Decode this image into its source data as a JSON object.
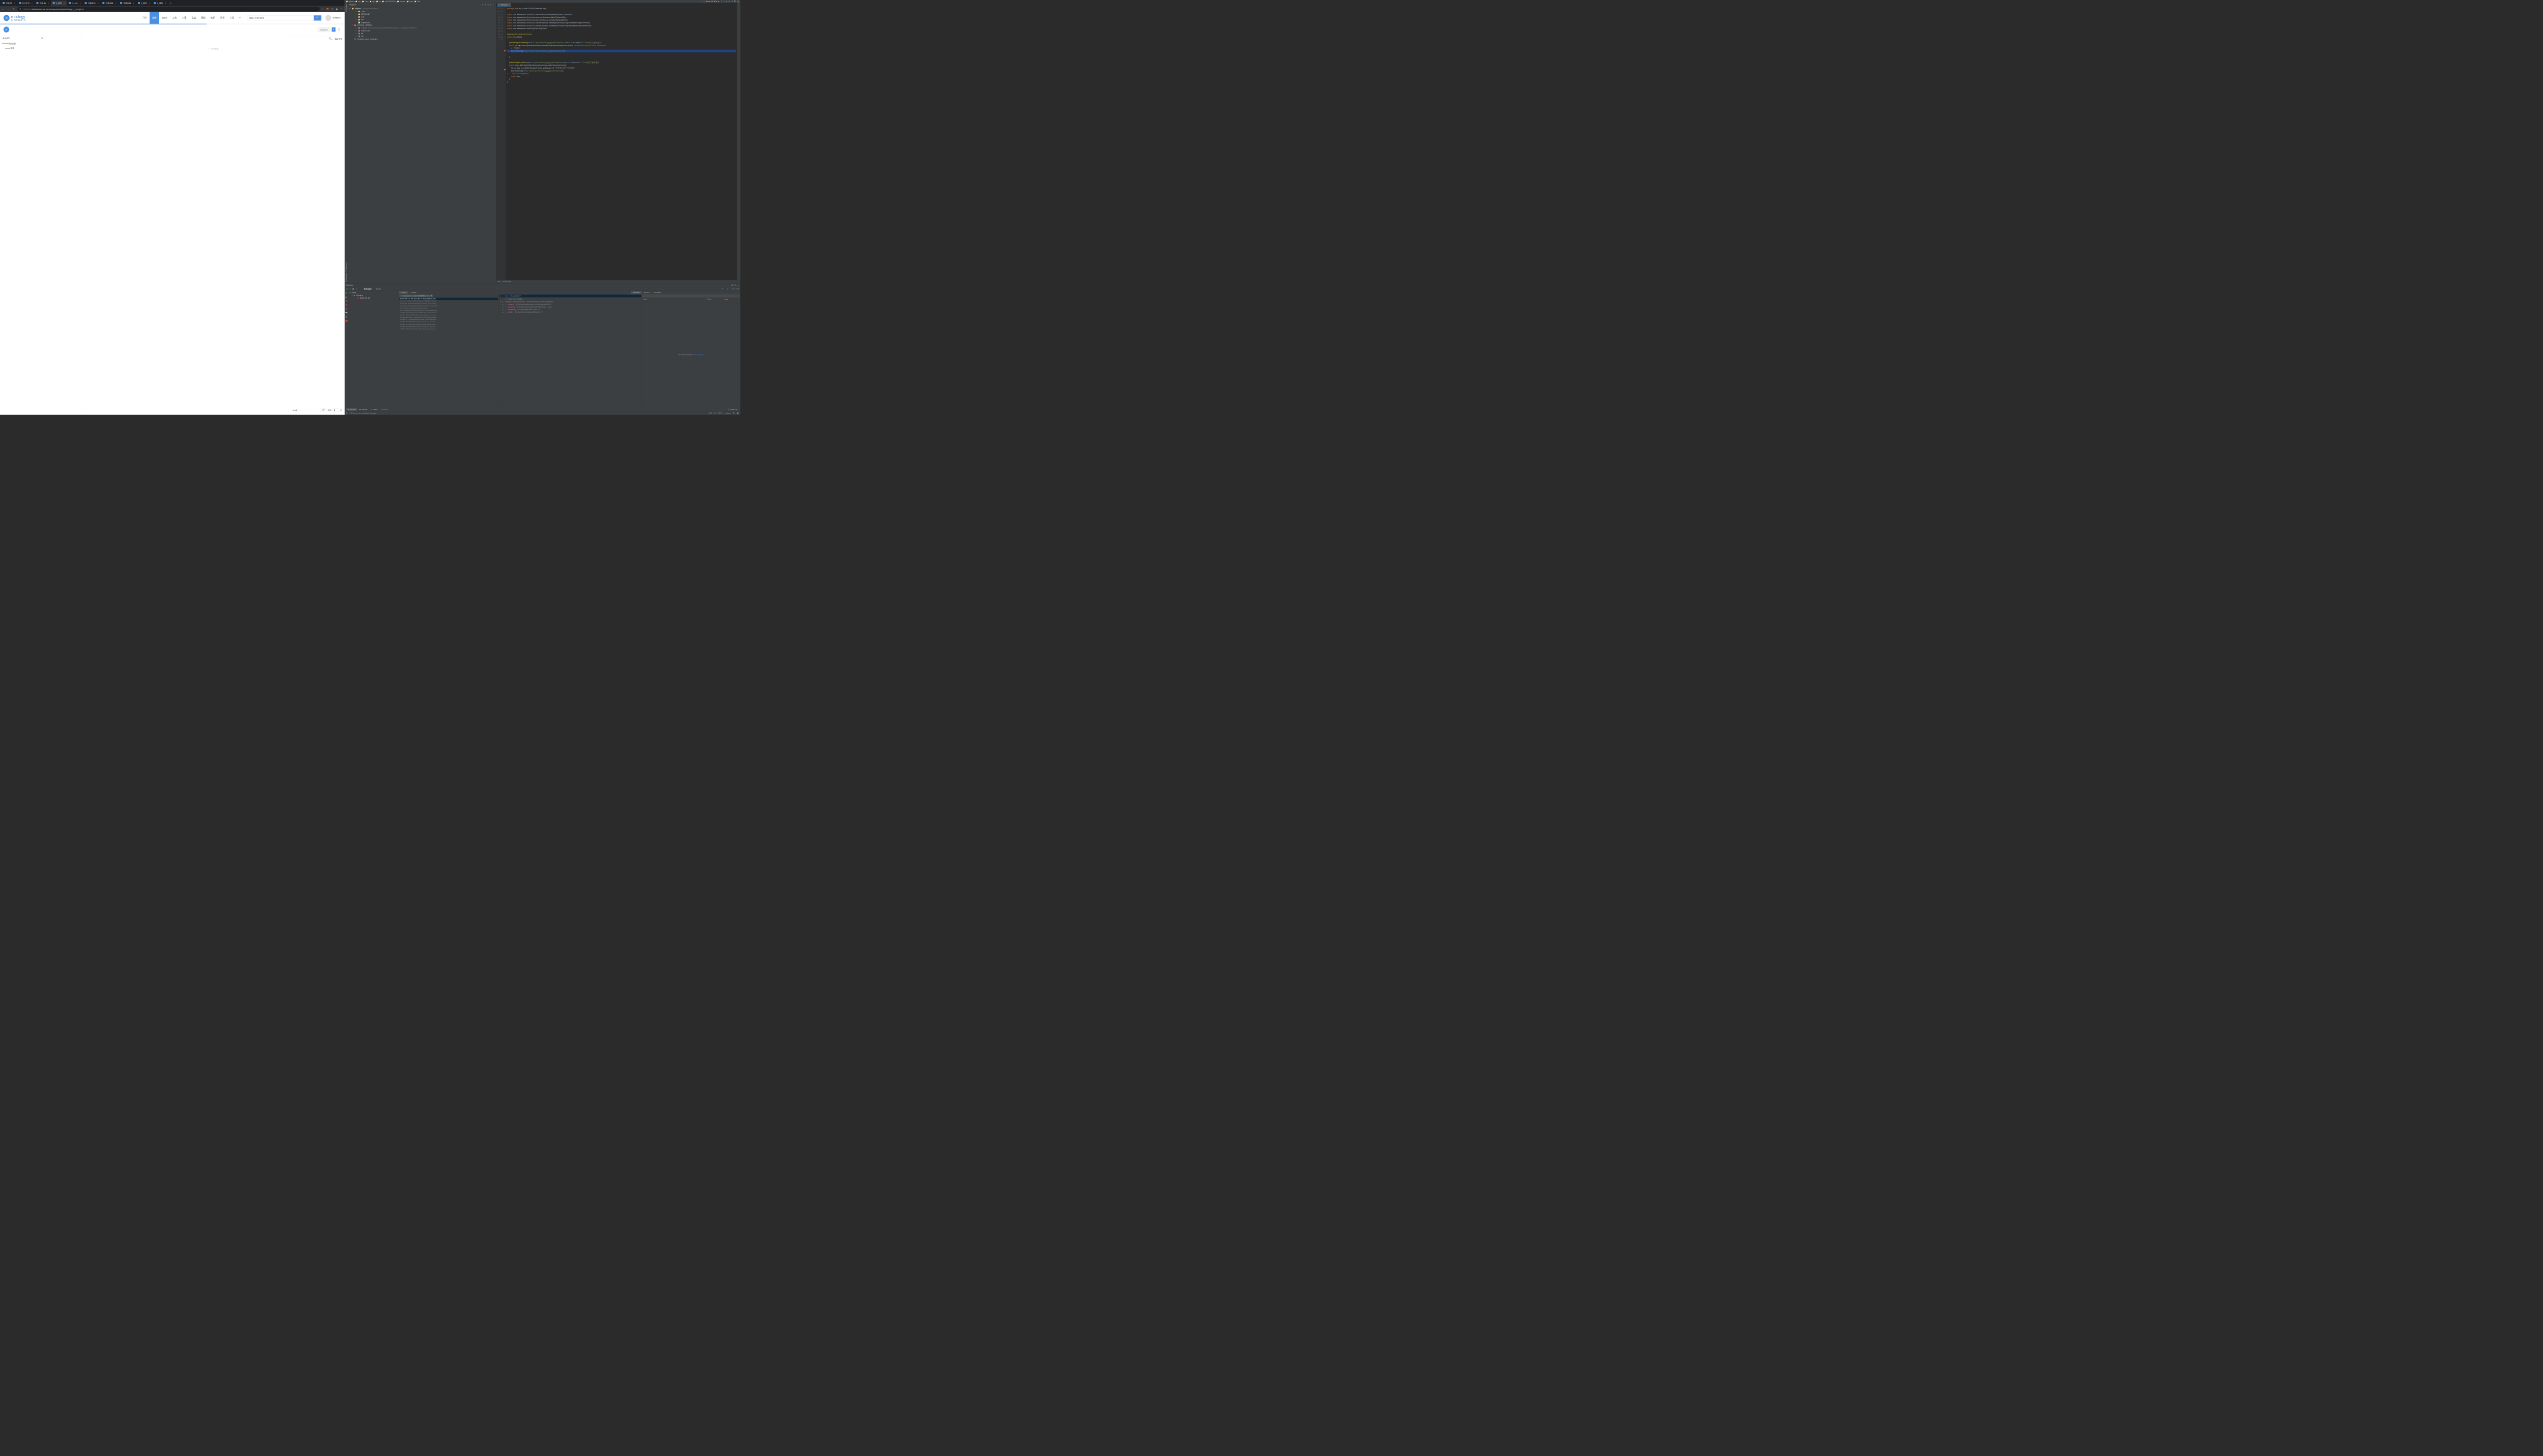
{
  "browser": {
    "tabs": [
      {
        "label": "泛微-协"
      },
      {
        "label": "EIM计划"
      },
      {
        "label": "泛微-协"
      },
      {
        "label": "6_蓝色",
        "active": true
      },
      {
        "label": "e-code"
      },
      {
        "label": "泛微在线"
      },
      {
        "label": "泛微在线"
      },
      {
        "label": "泛微在线"
      },
      {
        "label": "6_蓝色"
      },
      {
        "label": "6_蓝色"
      }
    ],
    "url": "127.0.0.1:8886/wui/index.html#/main/workflow/listDoing?_key=ljkl79"
  },
  "ecology": {
    "logo": "e-cology",
    "logo_sub": "新一代协同融合平台",
    "nav": [
      "门户",
      "流程",
      "demo",
      "工资",
      "人事",
      "会议",
      "建模",
      "知识",
      "日程",
      "人员"
    ],
    "nav_active": 1,
    "nav_more": "▾",
    "search_ph": "请输入关键词搜索",
    "user_name": "系统管理员",
    "sidebar_search": "全部类型",
    "tree": [
      {
        "label": "ecode测试类型",
        "exp": "▾"
      },
      {
        "label": "ecode测试",
        "child": true
      }
    ],
    "batch_btn": "批量提交",
    "adv_search": "高级搜索",
    "empty": "暂无数据",
    "pager_total": "共0条",
    "pager_size": "10 ▾",
    "pager_jump": "跳至",
    "pager_page": "1",
    "pager_unit": "页"
  },
  "ide": {
    "crumbs": [
      "e9java",
      "src",
      "com",
      "api",
      "cs",
      "test20200529",
      "service",
      "impl",
      "Test"
    ],
    "run_cfg": "Resin 4.0.58",
    "proj_hdr": "Project ▾",
    "proj_root": "e9java",
    "proj_root_path": "~/work/project/e9java",
    "tree": [
      {
        "d": 1,
        "arrow": "▸",
        "ico": "📁",
        "label": ".idea"
      },
      {
        "d": 1,
        "arrow": "▸",
        "ico": "📁",
        "label": "META-INF"
      },
      {
        "d": 1,
        "arrow": "▸",
        "ico": "📁",
        "label": "out",
        "cls": "excl"
      },
      {
        "d": 1,
        "arrow": "▸",
        "ico": "📁",
        "label": "src",
        "cls": "src"
      },
      {
        "d": 1,
        "arrow": "",
        "ico": "📄",
        "label": "e9java.iml"
      },
      {
        "d": 0,
        "arrow": "▾",
        "ico": "📚",
        "label": "External Libraries"
      },
      {
        "d": 1,
        "arrow": "▸",
        "ico": "📚",
        "label": "< 1.8 >",
        "dim": "/Library/Java/JavaVirtualMachines/jdk1.8.0_231.jdk/Contents/H"
      },
      {
        "d": 1,
        "arrow": "▸",
        "ico": "📚",
        "label": "classbean"
      },
      {
        "d": 1,
        "arrow": "▸",
        "ico": "📚",
        "label": "lib"
      },
      {
        "d": 1,
        "arrow": "▸",
        "ico": "📚",
        "label": "lib1"
      },
      {
        "d": 0,
        "arrow": "",
        "ico": "📎",
        "label": "Scratches and Consoles"
      }
    ],
    "editor_tab": "Test.java",
    "gutter_start": 1,
    "gutter_end": 27,
    "bp_lines": [
      16,
      23
    ],
    "code_lines": [
      "<span class='kw'>package</span> com.api.cs.test20200529.service.impl;",
      "",
      "<span class='kw'>import</span> com.weaverboot.frame.ioc.anno.classAnno.<span class='typ'>WeaIocReplaceComponent</span>;",
      "<span class='kw'>import</span> com.weaverboot.frame.ioc.anno.methodAnno.<span class='typ'>WeaReplaceAfter</span>;",
      "<span class='kw'>import</span> com.weaverboot.frame.ioc.anno.methodAnno.<span class='typ'>WeaReplaceBefore</span>;",
      "<span class='kw'>import</span> com.weaverboot.frame.ioc.handler.replace.weaReplaceParam.impl.WeaAfterReplaceParam;",
      "<span class='kw'>import</span> com.weaverboot.frame.ioc.handler.replace.weaReplaceParam.impl.WeaBeforeReplaceParam;",
      "<span class='kw'>import</span> com.weaverboot.tools.logTools.LogTools;",
      "",
      "<span class='ann'>@WeaIocReplaceComponent</span>",
      "<span class='kw'>public class</span> Test {",
      "",
      "    <span class='ann'>@WeaReplaceBefore</span>(<span class='num'>value</span> = <span class='str'>\"/api/workflow/<u>reqlist</u>/splitPageKey\"</span>,<span class='num'>order</span> = <span class='num'>1</span>,<span class='num'>description</span> = <span class='str'>\"Test测试拦截前置\"</span>)",
      "    <span class='kw'>public void</span> <span class='fn'>beforeTest</span>(WeaBeforeReplaceParam weaBeforeReplaceParam){   <span class='cm'>weaBeforeReplaceParam: WeaBefore…</span>",
      "        <span class='cm'>//一些操作</span>",
      "<span class='hl-line'>        LogTools.info( <span class='cm'>value:</span> <span class='str'>\"before:/api/workflow/<u>reqlist</u>/splitPageKey\"</span>);</span>",
      "",
      "    }",
      "",
      "    <span class='ann'>@WeaReplaceAfter</span>(<span class='num'>value</span> = <span class='str'>\"/api/workflow/<u>reqlist</u>/splitPageKey\"</span>,<span class='num'>order</span> = <span class='num'>1</span>,<span class='num'>description</span> = <span class='str'>\"Test测试拦截后置\"</span>)",
      "    <span class='kw'>public</span> String <span class='fn'>after</span>(WeaAfterReplaceParam weaAfterReplaceParam){",
      "        String data = weaAfterReplaceParam.getData();<span class='cm'>//这个就是接口执行完的报文</span>",
      "        LogTools.info( <span class='cm'>value:</span> <span class='str'>\"after:/api/workflow/<u>reqlist</u>/splitPageKey\"</span>);",
      "<span class='cm'>//        LogTools.info(data);</span>",
      "        <span class='kw'>return</span> data;",
      "    }",
      "}"
    ],
    "crumb_bar": [
      "Test",
      "beforeTest()"
    ],
    "svc_title": "Services",
    "svc_tabs": [
      "Debugger",
      "Server"
    ],
    "svc_tree": [
      {
        "d": 0,
        "arrow": "▾",
        "label": "Resin"
      },
      {
        "d": 1,
        "arrow": "▾",
        "label": "Running",
        "run": true
      },
      {
        "d": 2,
        "arrow": "",
        "label": "Resin 4.0.58",
        "ico": "🐞"
      }
    ],
    "svc_dd": "\"resin-port-8…main\": RUNNING",
    "frames_tabs": [
      "Frames",
      "Threads"
    ],
    "frames": [
      {
        "hl": true,
        "txt": "beforeTest:16, Test (com.api.cs.test20200529.serv…"
      },
      {
        "txt": "invoke0:-1, NativeMethodAccessorImpl (sun.reflect)"
      },
      {
        "txt": "invoke:62, NativeMethodAccessorImpl (sun.reflect)"
      },
      {
        "txt": "invoke:43, DelegatingMethodAccessorImpl (sun.refle…"
      },
      {
        "txt": "invoke:498, Method (java.lang.reflect)"
      },
      {
        "txt": "invokeReplaceApiBeforeMethod:84, WeaIocReplace…"
      },
      {
        "txt": "doFilter:66, WeaComponentFilter (com.weaverboot…"
      },
      {
        "txt": "doFilter:89, FilterFilterChain (com.caucho.server.d…"
      },
      {
        "txt": "doFilterInternal:28, FileNamingCheckFilter (weaver…"
      },
      {
        "txt": "doFilter:76, OncePerRequestFilter (org.springframe…"
      },
      {
        "txt": "doFilter:89, FilterFilterChain (com.caucho.server.d…"
      },
      {
        "txt": "doFilter:61, DateFormatFilter (weaver.dateformat)"
      },
      {
        "txt": "doFilter:89, FilterFilterChain (com.caucho.server.d…"
      },
      {
        "txt": "doFilter:455, SessionFilter (com.cloudstore.dev.ap…"
      }
    ],
    "var_tabs": [
      "Variables",
      "Memory",
      "Overhead"
    ],
    "vars": [
      {
        "sel": true,
        "arrow": "▾",
        "ico": "⏵",
        "name": "this",
        "val": "= {Test@28927}"
      },
      {
        "d": 1,
        "ico": "ⓘ",
        "txt": "Class has no fields"
      },
      {
        "arrow": "▸",
        "ico": "p",
        "name": "weaBeforeReplaceParam",
        "val": "= {WeaBeforeReplaceParam@289…"
      },
      {
        "d": 1,
        "arrow": "▸",
        "ico": "f",
        "name": "request",
        "val": "= {MultiLangHttpRequestForWebLogic@28929}"
      },
      {
        "d": 1,
        "arrow": "▸",
        "ico": "f",
        "name": "response",
        "val": "= {FileNamingCheckFilter$FileNamingI… View"
      },
      {
        "d": 1,
        "arrow": "▸",
        "ico": "f",
        "name": "paramMap",
        "val": "= {HashMap@28931}  size = 9"
      },
      {
        "d": 1,
        "arrow": "▸",
        "ico": "f",
        "name": "apiUrl",
        "val": "= \"/api/workflow/reqlist/splitPageKey\""
      }
    ],
    "mem_hdr": [
      "Class",
      "Count",
      "Diff ▾"
    ],
    "mem_empty": "No classes loaded.",
    "mem_link": "Load classes",
    "btm_tabs": [
      {
        "ico": "⚙",
        "label": "Services",
        "active": true
      },
      {
        "ico": "▣",
        "label": "Terminal"
      },
      {
        "ico": "✿",
        "label": "Spring"
      },
      {
        "ico": "☑",
        "label": "TODO"
      }
    ],
    "event_log": "Event Log",
    "status_msg": "All files are up-to-date (a minute ago)",
    "status_right": [
      "16:1",
      "LF",
      "UTF-8",
      "4 spaces"
    ]
  }
}
